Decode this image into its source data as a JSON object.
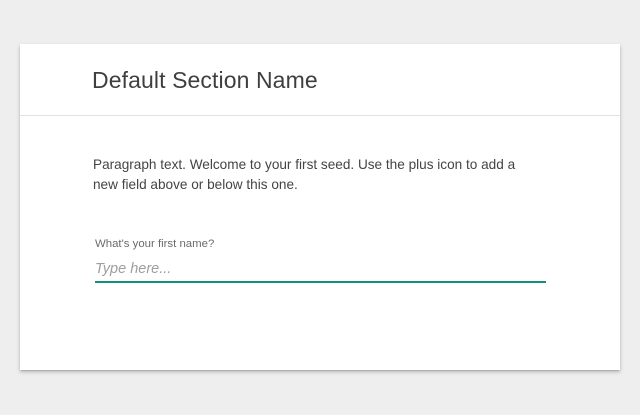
{
  "section": {
    "title": "Default Section Name"
  },
  "body": {
    "paragraph": "Paragraph text. Welcome to your first seed. Use the plus icon to add a new field above or below this one."
  },
  "field": {
    "label": "What's your first name?",
    "value": "",
    "placeholder": "Type here..."
  },
  "colors": {
    "background": "#eeeeee",
    "card": "#ffffff",
    "accent_underline": "#15907c",
    "title_text": "#3f3f3f"
  }
}
